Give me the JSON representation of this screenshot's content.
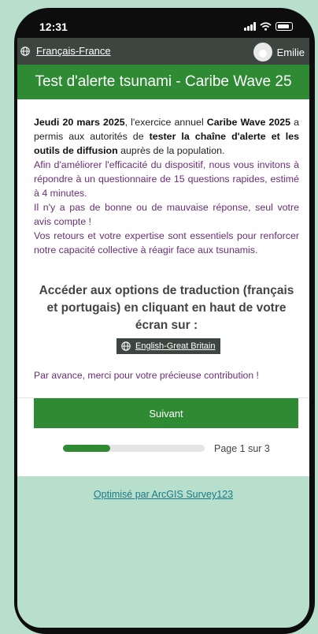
{
  "status_bar": {
    "time": "12:31"
  },
  "topbar": {
    "language": "Français-France",
    "user_name": "Emilie"
  },
  "header": {
    "title": "Test d'alerte tsunami - Caribe Wave 25"
  },
  "intro": {
    "date_bold": "Jeudi 20 mars 2025",
    "text_1": ", l'exercice annuel ",
    "exercise_bold": "Caribe Wave 2025",
    "text_2": " a permis aux autorités de ",
    "test_bold": "tester la chaîne d'alerte et les outils de diffusion",
    "text_3": " auprès de la population.",
    "paragraph_2": "Afin d'améliorer l'efficacité du dispositif, nous vous invitons à répondre à un questionnaire de 15 questions rapides, estimé à 4 minutes.",
    "paragraph_3": "Il n'y a pas de bonne ou de mauvaise réponse, seul votre avis compte !",
    "paragraph_4": "Vos retours et votre expertise sont essentiels pour renforcer notre capacité collective à réagir face aux tsunamis."
  },
  "translation": {
    "heading": "Accéder aux options de traduction (français et portugais) en cliquant en haut de votre écran sur :",
    "language_chip": "English-Great Britain"
  },
  "thanks": "Par avance, merci pour votre précieuse contribution !",
  "navigation": {
    "next_label": "Suivant",
    "page_indicator": "Page 1 sur 3",
    "progress_fraction": 0.333
  },
  "footer": {
    "link_text": "Optimisé par ArcGIS Survey123"
  },
  "colors": {
    "primary_green": "#2e8b33",
    "topbar": "#3d4541",
    "purple_text": "#6b2d77",
    "background": "#b7dfcc"
  }
}
